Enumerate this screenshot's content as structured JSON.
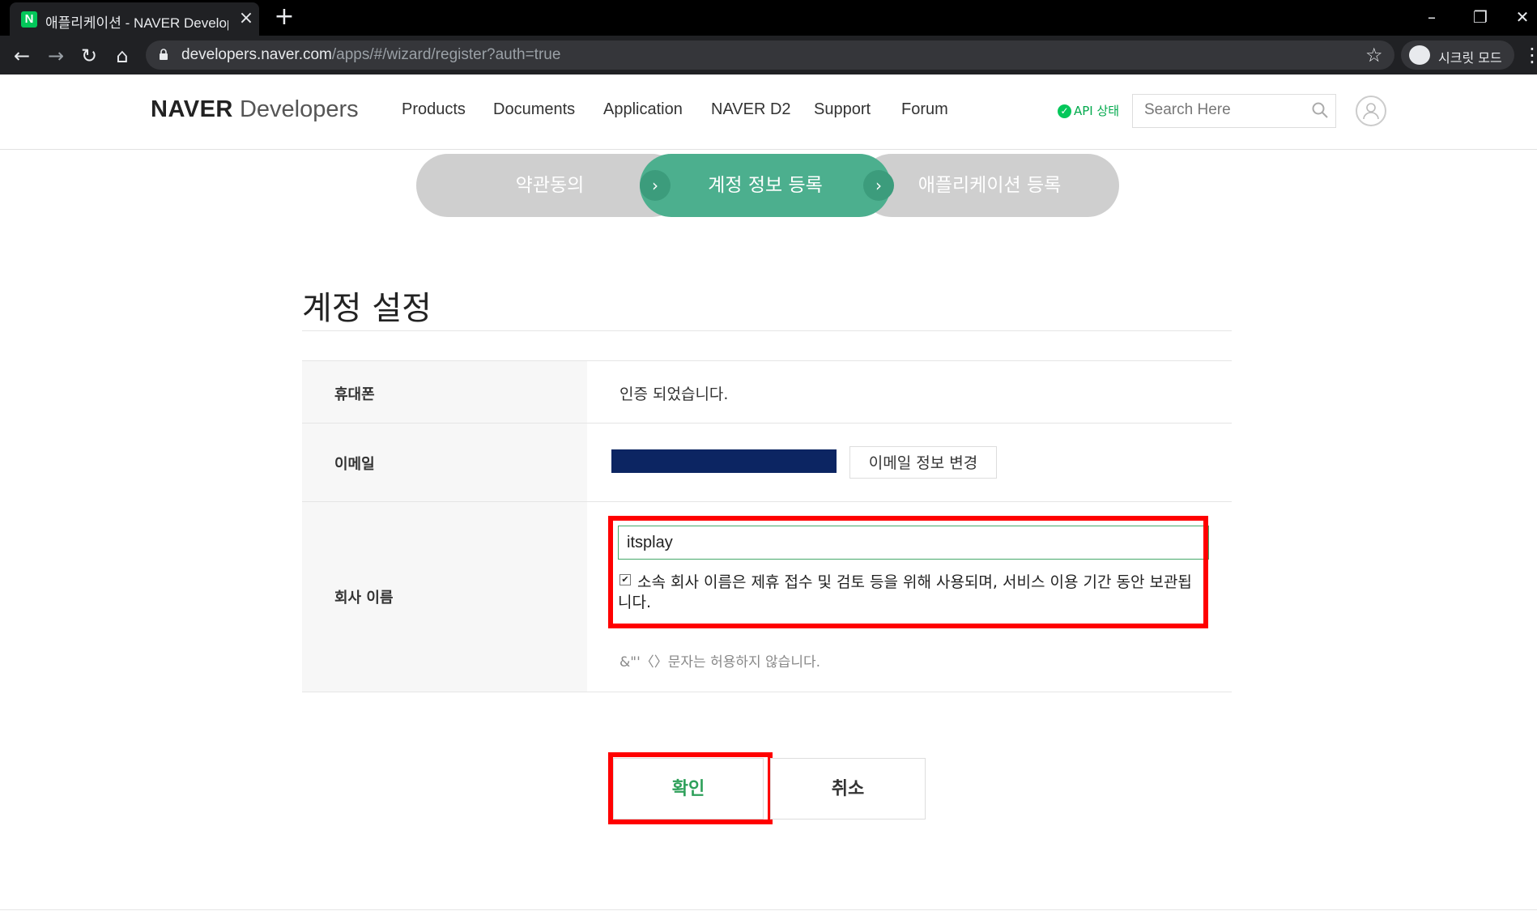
{
  "browser": {
    "tab_title": "애플리케이션 - NAVER Developers",
    "favicon_letter": "N",
    "url_host": "developers.naver.com",
    "url_path": "/apps/#/wizard/register?auth=true",
    "incognito_label": "시크릿 모드"
  },
  "header": {
    "logo_bold": "NAVER",
    "logo_light": "Developers",
    "nav": [
      "Products",
      "Documents",
      "Application",
      "NAVER D2",
      "Support",
      "Forum"
    ],
    "api_status": "API 상태",
    "search_placeholder": "Search Here"
  },
  "wizard": {
    "steps": [
      "약관동의",
      "계정 정보 등록",
      "애플리케이션 등록"
    ],
    "active_step": 2
  },
  "form": {
    "title": "계정 설정",
    "phone_label": "휴대폰",
    "phone_value": "인증 되었습니다.",
    "email_label": "이메일",
    "email_change_button": "이메일 정보 변경",
    "company_label": "회사 이름",
    "company_value": "itsplay",
    "company_consent_checked": true,
    "company_consent_text": "소속 회사 이름은 제휴 접수 및 검토 등을 위해 사용되며, 서비스 이용 기간 동안 보관됩니다.",
    "company_hint": "&\"'〈〉문자는 허용하지 않습니다."
  },
  "actions": {
    "confirm": "확인",
    "cancel": "취소"
  },
  "colors": {
    "active_step": "#4caf8e",
    "inactive_step": "#cfcfcf",
    "highlight": "#ff0000",
    "confirm_text": "#2ea05a"
  }
}
